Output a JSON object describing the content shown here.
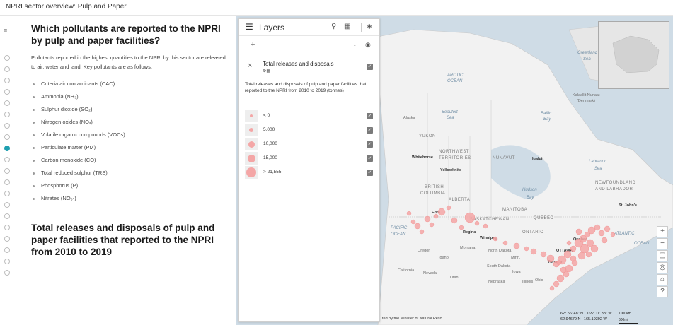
{
  "page": {
    "title": "NPRI sector overview: Pulp and Paper"
  },
  "story": {
    "heading": "Which pollutants are reported to the NPRI by pulp and paper facilities?",
    "intro": "Pollutants reported in the highest quantities to the NPRI by this sector are released to air, water and land. Key pollutants are as follows:",
    "pollutants": [
      "Criteria air contaminants (CAC):",
      "Ammonia (NH₃)",
      "Sulphur dioxide (SO₂)",
      "Nitrogen oxides (NOₓ)",
      "Volatile organic compounds (VOCs)",
      "Particulate matter (PM)",
      "Carbon monoxide (CO)",
      "Total reduced sulphur (TRS)",
      "Phosphorus (P)",
      "Nitrates (NO₃-)"
    ],
    "heading2": "Total releases and disposals of pulp and paper facilities that reported to the NPRI from 2010 to 2019"
  },
  "nav": {
    "active_index": 8
  },
  "layers": {
    "title": "Layers",
    "layer_name": "Total releases and disposals",
    "description": "Total releases and disposals of pulp and paper facilities that reported to the NPRI from 2010 to 2019 (tonnes)",
    "legend": [
      {
        "label": "< 0"
      },
      {
        "label": "5,000"
      },
      {
        "label": "10,000"
      },
      {
        "label": "15,000"
      },
      {
        "label": "> 21,555"
      }
    ]
  },
  "map": {
    "labels": [
      {
        "text": "ARCTIC",
        "kind": "ocean"
      },
      {
        "text": "OCEAN",
        "kind": "ocean"
      },
      {
        "text": "Greenland",
        "kind": "ocean"
      },
      {
        "text": "Sea",
        "kind": "ocean"
      },
      {
        "text": "Beaufort",
        "kind": "ocean"
      },
      {
        "text": "Sea",
        "kind": "ocean"
      },
      {
        "text": "Baffin",
        "kind": "ocean"
      },
      {
        "text": "Bay",
        "kind": "ocean"
      },
      {
        "text": "Alaska",
        "kind": "plain"
      },
      {
        "text": "Kalaallit Nunaat",
        "kind": "plain"
      },
      {
        "text": "(Denmark)",
        "kind": "plain"
      },
      {
        "text": "YUKON",
        "kind": "region"
      },
      {
        "text": "NORTHWEST",
        "kind": "region"
      },
      {
        "text": "TERRITORIES",
        "kind": "region"
      },
      {
        "text": "NUNAVUT",
        "kind": "region"
      },
      {
        "text": "Whitehorse",
        "kind": "city"
      },
      {
        "text": "Yellowknife",
        "kind": "city"
      },
      {
        "text": "Iqaluit",
        "kind": "city"
      },
      {
        "text": "Labrador",
        "kind": "ocean"
      },
      {
        "text": "Sea",
        "kind": "ocean"
      },
      {
        "text": "BRITISH",
        "kind": "region"
      },
      {
        "text": "COLUMBIA",
        "kind": "region"
      },
      {
        "text": "ALBERTA",
        "kind": "region"
      },
      {
        "text": "Hudson",
        "kind": "ocean"
      },
      {
        "text": "Bay",
        "kind": "ocean"
      },
      {
        "text": "NEWFOUNDLAND",
        "kind": "region"
      },
      {
        "text": "AND LABRADOR",
        "kind": "region"
      },
      {
        "text": "St. John's",
        "kind": "city"
      },
      {
        "text": "MANITOBA",
        "kind": "region"
      },
      {
        "text": "SASKATCHEWAN",
        "kind": "region"
      },
      {
        "text": "Edm",
        "kind": "city"
      },
      {
        "text": "QUEBEC",
        "kind": "region"
      },
      {
        "text": "PACIFIC",
        "kind": "ocean"
      },
      {
        "text": "OCEAN",
        "kind": "ocean"
      },
      {
        "text": "Regina",
        "kind": "city"
      },
      {
        "text": "Winnipeg",
        "kind": "city"
      },
      {
        "text": "ONTARIO",
        "kind": "region"
      },
      {
        "text": "ATLANTIC",
        "kind": "ocean"
      },
      {
        "text": "OCEAN",
        "kind": "ocean"
      },
      {
        "text": "Montana",
        "kind": "plain"
      },
      {
        "text": "Oregon",
        "kind": "plain"
      },
      {
        "text": "Idaho",
        "kind": "plain"
      },
      {
        "text": "North Dakota",
        "kind": "plain"
      },
      {
        "text": "OTTAWA",
        "kind": "city"
      },
      {
        "text": "Toronto",
        "kind": "city"
      },
      {
        "text": "Quebec",
        "kind": "city"
      },
      {
        "text": "Nevada",
        "kind": "plain"
      },
      {
        "text": "Utah",
        "kind": "plain"
      },
      {
        "text": "California",
        "kind": "plain"
      },
      {
        "text": "South Dakota",
        "kind": "plain"
      },
      {
        "text": "Nebraska",
        "kind": "plain"
      },
      {
        "text": "Iowa",
        "kind": "plain"
      },
      {
        "text": "Minn.",
        "kind": "plain"
      },
      {
        "text": "Illinois",
        "kind": "plain"
      },
      {
        "text": "Ohio",
        "kind": "plain"
      }
    ],
    "coords_line1": "62° 56' 48\" N | 165° 11' 38\" W",
    "coords_line2": "62.94679 N | 165.19392 W",
    "scale_km": "1000km",
    "scale_mi": "600mi",
    "attribution": "ted by the Minister of Natural Reso..."
  },
  "colors": {
    "accent": "#1e9fb0",
    "bubble": "#f4a6a6",
    "water": "#cfdce6",
    "land": "#f2f2f2"
  }
}
